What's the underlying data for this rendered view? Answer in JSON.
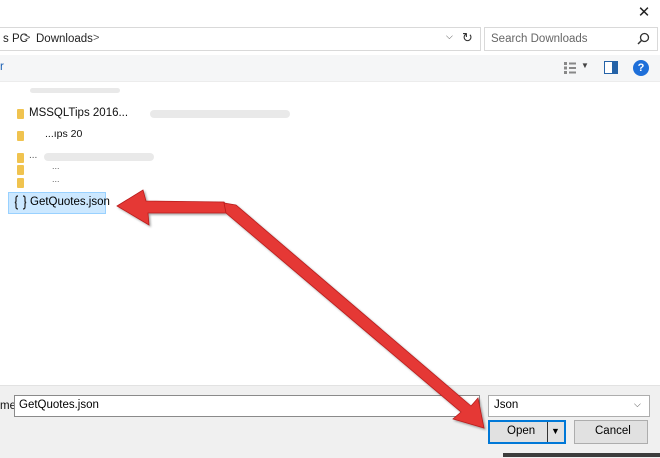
{
  "window": {
    "close_glyph": "✕"
  },
  "address_bar": {
    "crumbs": [
      "s PC",
      "Downloads"
    ],
    "separator": ">",
    "dropdown_glyph": "⌵",
    "refresh_glyph": "↻"
  },
  "search": {
    "placeholder": "Search Downloads",
    "icon": "search-icon"
  },
  "toolbar": {
    "left_fragment": "r",
    "help_glyph": "?",
    "icons": [
      "view-options-icon",
      "preview-pane-icon",
      "help-icon"
    ]
  },
  "files": {
    "rows": [
      {
        "label": "MSSQLTips 2016...",
        "type": "folder"
      },
      {
        "label": "...ıps 20",
        "type": "folder"
      },
      {
        "label": "...",
        "type": "folder"
      },
      {
        "label": "...",
        "type": "folder"
      },
      {
        "label": "...",
        "type": "folder"
      }
    ],
    "selected": {
      "label": "GetQuotes.json",
      "icon": "json-file-icon"
    }
  },
  "bottom": {
    "filename_label": "me:",
    "filename_value": "GetQuotes.json",
    "filetype_value": "Json",
    "open_label": "Open",
    "cancel_label": "Cancel",
    "caret_glyph": "▼",
    "select_caret": "⌵"
  },
  "colors": {
    "accent": "#0078d7",
    "selection": "#cce8ff",
    "arrow": "#e53935",
    "folder": "#f0c34f"
  }
}
